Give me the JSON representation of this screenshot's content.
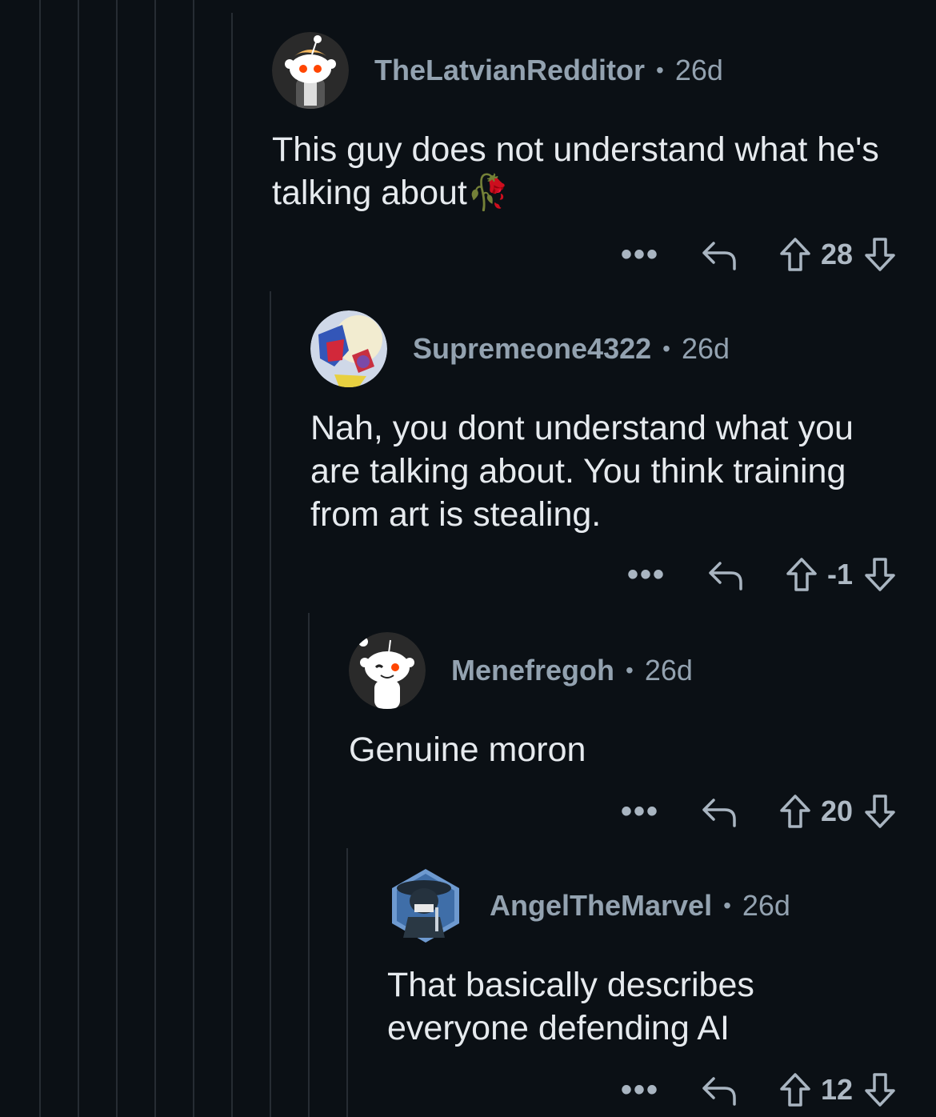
{
  "comments": [
    {
      "username": "TheLatvianRedditor",
      "age": "26d",
      "body": "This guy does not understand what he's talking about",
      "emoji": "🥀",
      "score": "28",
      "avatar_icon": "snoo-avatar-icon"
    },
    {
      "username": "Supremeone4322",
      "age": "26d",
      "body": "Nah, you dont understand what you are talking about. You think training from art is stealing.",
      "emoji": "",
      "score": "-1",
      "avatar_icon": "anime-avatar-icon"
    },
    {
      "username": "Menefregoh",
      "age": "26d",
      "body": "Genuine moron",
      "emoji": "",
      "score": "20",
      "avatar_icon": "snoo-avatar-icon"
    },
    {
      "username": "AngelTheMarvel",
      "age": "26d",
      "body": "That basically describes everyone defending AI",
      "emoji": "",
      "score": "12",
      "avatar_icon": "alien-avatar-icon"
    }
  ],
  "separator": "•",
  "actions": {
    "more": "•••"
  },
  "colors": {
    "background": "#0b1015",
    "thread_line": "#262c33",
    "meta_text": "#93a2b0",
    "body_text": "#e6eaee"
  }
}
